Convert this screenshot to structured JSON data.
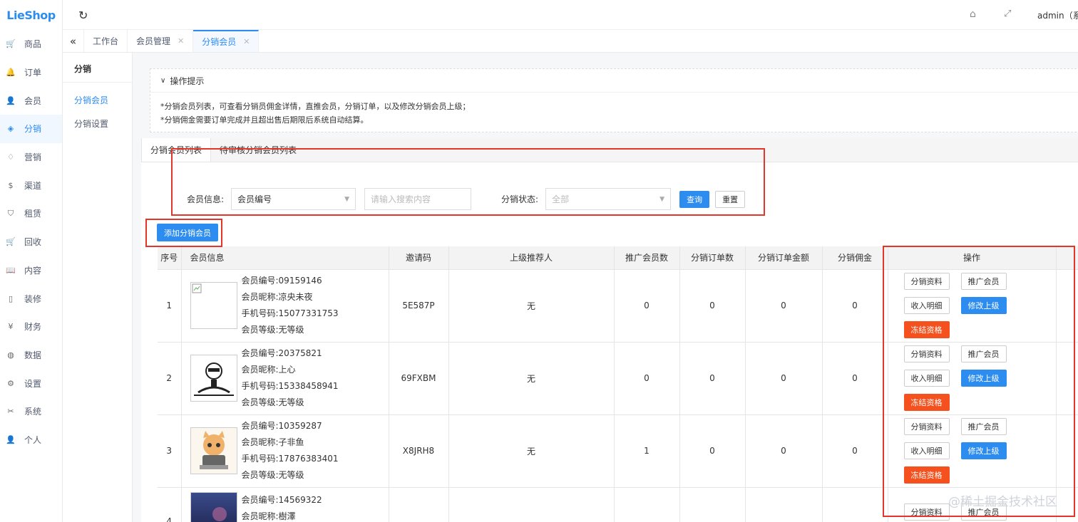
{
  "logo": {
    "part1": "Lie",
    "part2": "Shop"
  },
  "nav": [
    {
      "label": "商品",
      "icon": "cart-icon",
      "glyph": "🛒"
    },
    {
      "label": "订单",
      "icon": "bell-icon",
      "glyph": "🔔"
    },
    {
      "label": "会员",
      "icon": "user-icon",
      "glyph": "👤"
    },
    {
      "label": "分销",
      "icon": "layers-icon",
      "glyph": "◈"
    },
    {
      "label": "营销",
      "icon": "diamond-icon",
      "glyph": "♢"
    },
    {
      "label": "渠道",
      "icon": "dollar-icon",
      "glyph": "$"
    },
    {
      "label": "租赁",
      "icon": "shield-icon",
      "glyph": "⛉"
    },
    {
      "label": "回收",
      "icon": "cart-icon",
      "glyph": "🛒"
    },
    {
      "label": "内容",
      "icon": "book-icon",
      "glyph": "📖"
    },
    {
      "label": "装修",
      "icon": "phone-icon",
      "glyph": "▯"
    },
    {
      "label": "财务",
      "icon": "money-icon",
      "glyph": "¥"
    },
    {
      "label": "数据",
      "icon": "globe-icon",
      "glyph": "◍"
    },
    {
      "label": "设置",
      "icon": "gear-icon",
      "glyph": "⚙"
    },
    {
      "label": "系统",
      "icon": "tools-icon",
      "glyph": "✂"
    },
    {
      "label": "个人",
      "icon": "person-icon",
      "glyph": "👤"
    }
  ],
  "header": {
    "user": "admin（系"
  },
  "tabs": [
    {
      "label": "工作台",
      "closable": false
    },
    {
      "label": "会员管理",
      "closable": true
    },
    {
      "label": "分销会员",
      "closable": true
    }
  ],
  "submenu": {
    "title": "分销",
    "items": [
      "分销会员",
      "分销设置"
    ]
  },
  "tips": {
    "title": "操作提示",
    "lines": [
      "*分销会员列表，可查看分销员佣金详情，直推会员，分销订单，以及修改分销会员上级；",
      "*分销佣金需要订单完成并且超出售后期限后系统自动结算。"
    ]
  },
  "panel_tabs": [
    "分销会员列表",
    "待审核分销会员列表"
  ],
  "search": {
    "member_label": "会员信息:",
    "member_select": "会员编号",
    "keyword_placeholder": "请输入搜索内容",
    "status_label": "分销状态:",
    "status_select": "全部",
    "query": "查询",
    "reset": "重置"
  },
  "add_button": "添加分销会员",
  "columns": [
    "序号",
    "会员信息",
    "邀请码",
    "上级推荐人",
    "推广会员数",
    "分销订单数",
    "分销订单金额",
    "分销佣金",
    "操作"
  ],
  "rows": [
    {
      "index": "1",
      "member_no": "会员编号:09159146",
      "nickname": "会员昵称:凉央未夜",
      "phone": "手机号码:15077331753",
      "level": "会员等级:无等级",
      "invite": "5E587P",
      "parent": "无",
      "promoted": "0",
      "orders": "0",
      "amount": "0",
      "commission": "0",
      "avatar": "broken"
    },
    {
      "index": "2",
      "member_no": "会员编号:20375821",
      "nickname": "会员昵称:上心",
      "phone": "手机号码:15338458941",
      "level": "会员等级:无等级",
      "invite": "69FXBM",
      "parent": "无",
      "promoted": "0",
      "orders": "0",
      "amount": "0",
      "commission": "0",
      "avatar": "sketch"
    },
    {
      "index": "3",
      "member_no": "会员编号:10359287",
      "nickname": "会员昵称:子非鱼",
      "phone": "手机号码:17876383401",
      "level": "会员等级:无等级",
      "invite": "X8JRH8",
      "parent": "无",
      "promoted": "1",
      "orders": "0",
      "amount": "0",
      "commission": "0",
      "avatar": "cat"
    },
    {
      "index": "4",
      "member_no": "会员编号:14569322",
      "nickname": "会员昵称:樹澤",
      "phone": "",
      "level": "",
      "invite": "",
      "parent": "",
      "promoted": "",
      "orders": "",
      "amount": "",
      "commission": "",
      "avatar": "night"
    }
  ],
  "ops": {
    "profile": "分销资料",
    "promoted_members": "推广会员",
    "income": "收入明细",
    "change_parent": "修改上级",
    "freeze": "冻结资格"
  },
  "watermark": "@稀土掘金技术社区",
  "colors": {
    "primary": "#2d8cf0",
    "danger": "#f4511e",
    "highlight": "#e4352a"
  }
}
